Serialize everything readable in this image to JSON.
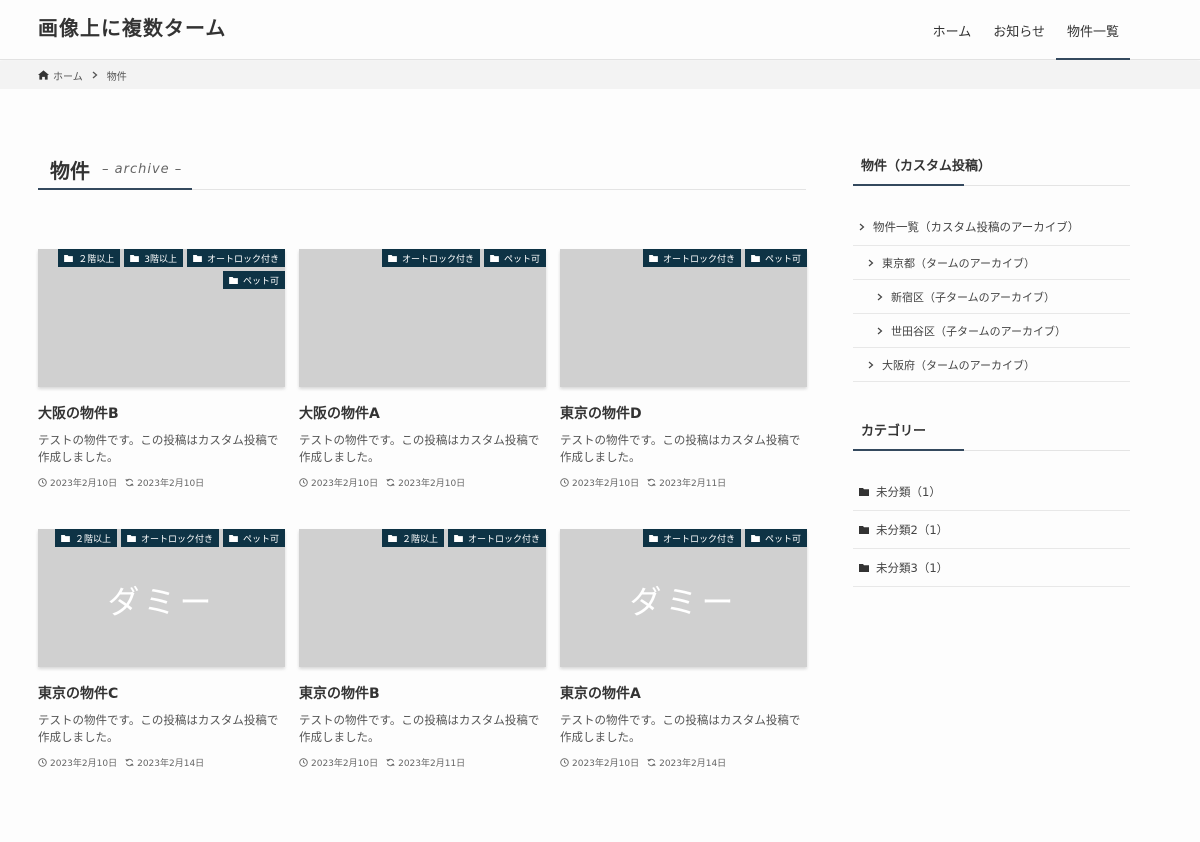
{
  "site": {
    "title": "画像上に複数ターム"
  },
  "nav": {
    "items": [
      "ホーム",
      "お知らせ",
      "物件一覧"
    ]
  },
  "breadcrumb": {
    "home": "ホーム",
    "current": "物件"
  },
  "archive": {
    "title": "物件",
    "subtitle": "– archive –"
  },
  "posts": [
    {
      "title": "大阪の物件B",
      "excerpt": "テストの物件です。この投稿はカスタム投稿で作成しました。",
      "published": "2023年2月10日",
      "updated": "2023年2月10日",
      "tags": [
        "２階以上",
        "3階以上",
        "オートロック付き",
        "ペット可"
      ],
      "thumb_text": ""
    },
    {
      "title": "大阪の物件A",
      "excerpt": "テストの物件です。この投稿はカスタム投稿で作成しました。",
      "published": "2023年2月10日",
      "updated": "2023年2月10日",
      "tags": [
        "オートロック付き",
        "ペット可"
      ],
      "thumb_text": ""
    },
    {
      "title": "東京の物件D",
      "excerpt": "テストの物件です。この投稿はカスタム投稿で作成しました。",
      "published": "2023年2月10日",
      "updated": "2023年2月11日",
      "tags": [
        "オートロック付き",
        "ペット可"
      ],
      "thumb_text": ""
    },
    {
      "title": "東京の物件C",
      "excerpt": "テストの物件です。この投稿はカスタム投稿で作成しました。",
      "published": "2023年2月10日",
      "updated": "2023年2月14日",
      "tags": [
        "２階以上",
        "オートロック付き",
        "ペット可"
      ],
      "thumb_text": "ダミー"
    },
    {
      "title": "東京の物件B",
      "excerpt": "テストの物件です。この投稿はカスタム投稿で作成しました。",
      "published": "2023年2月10日",
      "updated": "2023年2月11日",
      "tags": [
        "２階以上",
        "オートロック付き"
      ],
      "thumb_text": ""
    },
    {
      "title": "東京の物件A",
      "excerpt": "テストの物件です。この投稿はカスタム投稿で作成しました。",
      "published": "2023年2月10日",
      "updated": "2023年2月14日",
      "tags": [
        "オートロック付き",
        "ペット可"
      ],
      "thumb_text": "ダミー"
    }
  ],
  "sidebar": {
    "property_widget": {
      "title": "物件（カスタム投稿）",
      "items": [
        "物件一覧（カスタム投稿のアーカイブ）",
        "東京都（タームのアーカイブ）",
        "新宿区（子タームのアーカイブ）",
        "世田谷区（子タームのアーカイブ）",
        "大阪府（タームのアーカイブ）"
      ]
    },
    "category_widget": {
      "title": "カテゴリー",
      "items": [
        "未分類（1）",
        "未分類2（1）",
        "未分類3（1）"
      ]
    }
  },
  "colors": {
    "accent": "#34495e",
    "tag_bg": "#0e3345",
    "thumb_bg": "#d0d0d0"
  }
}
